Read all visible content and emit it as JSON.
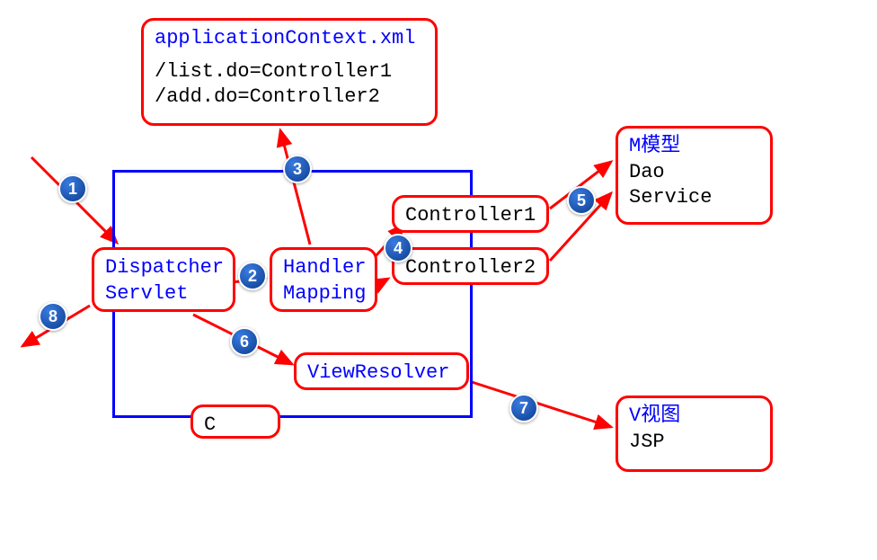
{
  "appContext": {
    "title": "applicationContext.xml",
    "line1": "/list.do=Controller1",
    "line2": "/add.do=Controller2"
  },
  "dispatcher": {
    "line1": "Dispatcher",
    "line2": "Servlet"
  },
  "handler": {
    "line1": "Handler",
    "line2": "Mapping"
  },
  "controller1": {
    "label": "Controller1"
  },
  "controller2": {
    "label": "Controller2"
  },
  "viewResolver": {
    "label": "ViewResolver"
  },
  "cBox": {
    "label": "C"
  },
  "model": {
    "title": "M模型",
    "line1": "Dao",
    "line2": "Service"
  },
  "view": {
    "title": "V视图",
    "line1": "JSP"
  },
  "steps": {
    "s1": "1",
    "s2": "2",
    "s3": "3",
    "s4": "4",
    "s5": "5",
    "s6": "6",
    "s7": "7",
    "s8": "8"
  }
}
